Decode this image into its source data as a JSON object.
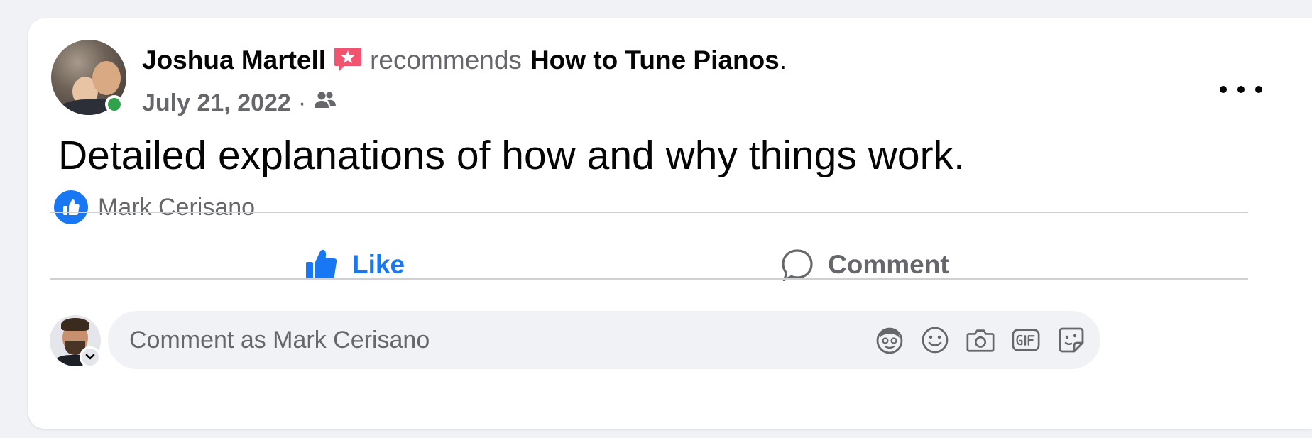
{
  "post": {
    "author": "Joshua Martell",
    "recommends_text": "recommends",
    "page_name": "How to Tune Pianos",
    "page_suffix": ".",
    "date": "July 21, 2022",
    "date_separator": "·",
    "audience_icon": "friends-icon",
    "text": "Detailed explanations of how and why things work."
  },
  "reactions": {
    "icon": "like-icon",
    "names": "Mark Cerisano"
  },
  "actions": {
    "like_label": "Like",
    "comment_label": "Comment"
  },
  "comment_composer": {
    "placeholder": "Comment as Mark Cerisano",
    "tools": [
      "avatar-sticker-icon",
      "emoji-icon",
      "camera-icon",
      "gif-icon",
      "sticker-icon"
    ]
  },
  "colors": {
    "brand_blue": "#1877f2",
    "online_green": "#31a24c",
    "badge_pink": "#f2536e",
    "secondary_text": "#65676b"
  }
}
